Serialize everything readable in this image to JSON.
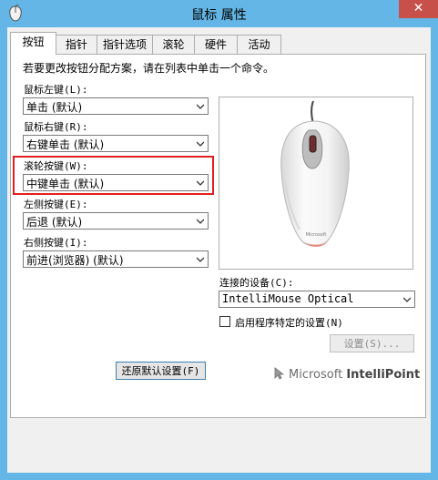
{
  "window": {
    "title": "鼠标 属性",
    "close_symbol": "✕"
  },
  "tabs": [
    {
      "label": "按钮",
      "active": true
    },
    {
      "label": "指针"
    },
    {
      "label": "指针选项"
    },
    {
      "label": "滚轮"
    },
    {
      "label": "硬件"
    },
    {
      "label": "活动"
    }
  ],
  "buttons_tab": {
    "intro": "若要更改按钮分配方案，请在列表中单击一个命令。",
    "left_button": {
      "label": "鼠标左键(L):",
      "value": "单击 (默认)"
    },
    "right_button": {
      "label": "鼠标右键(R):",
      "value": "右键单击 (默认)"
    },
    "wheel_button": {
      "label": "滚轮按键(W):",
      "value": "中键单击 (默认)"
    },
    "left_side_button": {
      "label": "左侧按键(E):",
      "value": "后退 (默认)"
    },
    "right_side_button": {
      "label": "右侧按键(I):",
      "value": "前进(浏览器) (默认)"
    },
    "restore_defaults_label": "还原默认设置(F)",
    "device": {
      "label": "连接的设备(C):",
      "value": "IntelliMouse Optical"
    },
    "program_specific": {
      "label": "启用程序特定的设置(N)",
      "checked": false
    },
    "settings_button_label": "设置(S)...",
    "brand": {
      "microsoft": "Microsoft",
      "intellipoint": "IntelliPoint"
    }
  },
  "colors": {
    "titlebar": "#63b6e6",
    "close": "#c7504b",
    "highlight": "#e02020"
  },
  "icons": [
    "mouse-app-icon",
    "close-icon",
    "chevron-down-icon",
    "mouse-image",
    "cursor-icon"
  ]
}
